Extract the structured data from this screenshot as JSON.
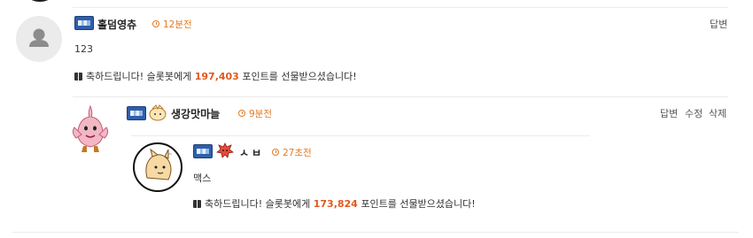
{
  "comments": [
    {
      "nickname": "홀덤영츄",
      "time": "12분전",
      "body": "123",
      "gift_pre": "축하드립니다! 슬롯봇에게",
      "gift_points": "197,403",
      "gift_post": "포인트를 선물받으셨습니다!",
      "actions": [
        "답변"
      ]
    },
    {
      "nickname": "생강맛마늘",
      "time": "9분전",
      "actions": [
        "답변",
        "수정",
        "삭제"
      ]
    },
    {
      "nickname": "ㅅㅂ",
      "time": "27초전",
      "body": "맥스",
      "gift_pre": "축하드립니다! 슬롯봇에게",
      "gift_points": "173,824",
      "gift_post": "포인트를 선물받으셨습니다!"
    }
  ]
}
